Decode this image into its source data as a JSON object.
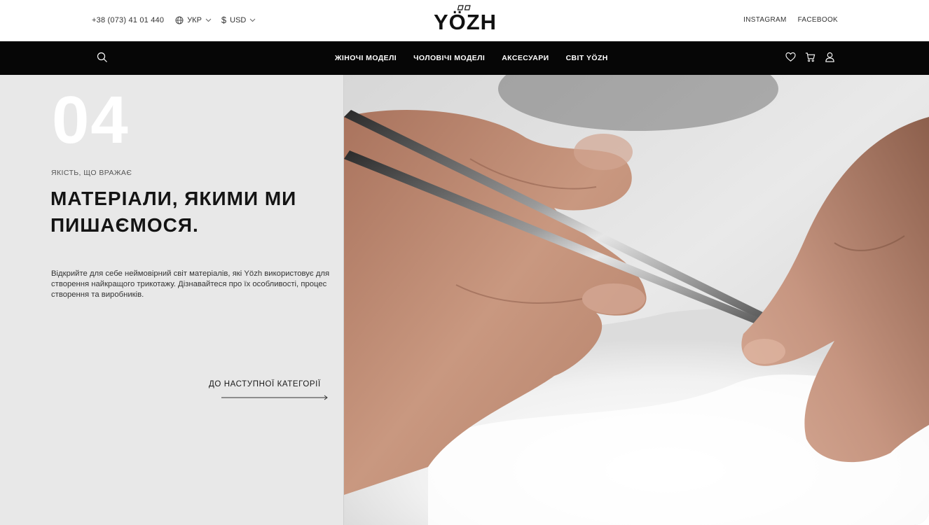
{
  "header": {
    "phone": "+38 (073) 41 01 440",
    "language": "УКР",
    "currency_symbol": "$",
    "currency": "USD",
    "logo": "YÖZH",
    "social": [
      "INSTAGRAM",
      "FACEBOOK"
    ]
  },
  "nav": {
    "links": [
      "ЖІНОЧІ МОДЕЛІ",
      "ЧОЛОВІЧІ МОДЕЛІ",
      "АКСЕСУАРИ",
      "СВІТ YÖZH"
    ],
    "icons": [
      "search-icon",
      "heart-icon",
      "cart-icon",
      "user-icon"
    ]
  },
  "section": {
    "number": "04",
    "eyebrow": "ЯКІСТЬ, ЩО ВРАЖАЄ",
    "title": "МАТЕРІАЛИ, ЯКИМИ МИ ПИШАЄМОСЯ.",
    "description": "Відкрийте для себе неймовірний світ матеріалів, які Yözh використовує для створення найкращого трикотажу. Дізнавайтеся про їх особливості, процес створення та виробників.",
    "next_label": "ДО НАСТУПНОЇ КАТЕГОРІЇ"
  },
  "colors": {
    "nav_bg": "#060606",
    "panel_bg": "#e8e8e8",
    "text": "#141414"
  }
}
